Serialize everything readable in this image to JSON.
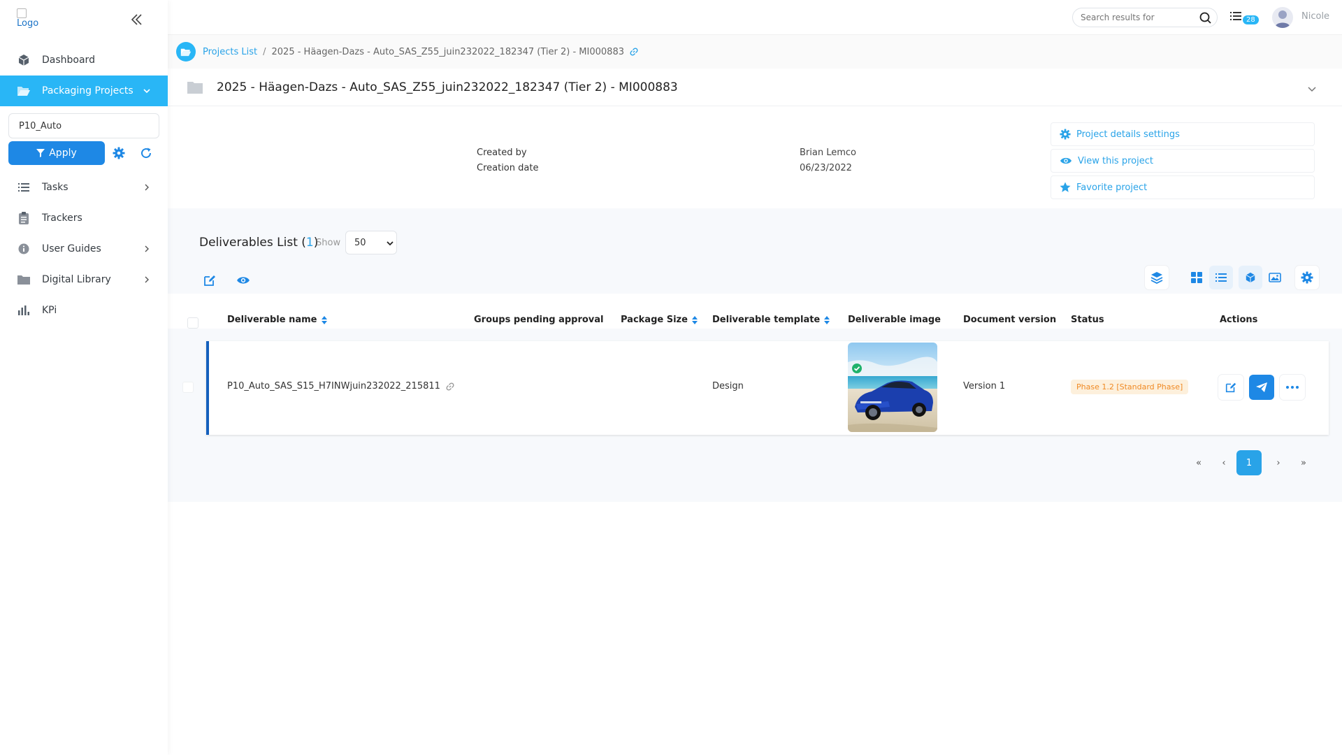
{
  "sidebar": {
    "logo_alt": "Logo",
    "items": [
      {
        "label": "Dashboard",
        "icon": "cube-icon"
      },
      {
        "label": "Packaging Projects",
        "icon": "folder-open-icon",
        "active": true
      },
      {
        "label": "Tasks",
        "icon": "list-icon"
      },
      {
        "label": "Trackers",
        "icon": "clipboard-icon"
      },
      {
        "label": "User Guides",
        "icon": "info-icon"
      },
      {
        "label": "Digital Library",
        "icon": "folder-icon"
      },
      {
        "label": "KPi",
        "icon": "bar-chart-icon"
      }
    ],
    "filter_value": "P10_Auto",
    "apply_label": "Apply"
  },
  "topbar": {
    "search_placeholder": "Search results for",
    "task_count": "28",
    "username": "Nicole"
  },
  "breadcrumb": {
    "link": "Projects List",
    "separator": "/",
    "current": "2025 - Häagen-Dazs - Auto_SAS_Z55_juin232022_182347 (Tier 2) - MI000883"
  },
  "project": {
    "title": "2025 - Häagen-Dazs - Auto_SAS_Z55_juin232022_182347 (Tier 2) - MI000883",
    "created_by_label": "Created by",
    "created_by_value": "Brian Lemco",
    "creation_date_label": "Creation date",
    "creation_date_value": "06/23/2022",
    "actions": [
      "Project details settings",
      "View this project",
      "Favorite project"
    ]
  },
  "deliverables": {
    "title": "Deliverables List",
    "count_open": "(",
    "count": "1",
    "count_close": ")",
    "show_label": "Show",
    "show_value": "50",
    "columns": [
      "Deliverable name",
      "Groups pending approval",
      "Package Size",
      "Deliverable template",
      "Deliverable image",
      "Document version",
      "Status",
      "Actions"
    ],
    "rows": [
      {
        "name": "P10_Auto_SAS_S15_H7INWjuin232022_215811",
        "groups_pending": "",
        "package_size": "",
        "template": "Design",
        "image": "blue-car-on-beach",
        "version": "Version 1",
        "status": "Phase 1.2 [Standard Phase]"
      }
    ],
    "pagination": {
      "first": "«",
      "prev": "‹",
      "current": "1",
      "next": "›",
      "last": "»"
    }
  },
  "colors": {
    "accent": "#29b6f6",
    "primary": "#1e88e5",
    "row_border": "#1560bd",
    "status_bg": "#fdf0dc",
    "status_text": "#f08a24"
  }
}
